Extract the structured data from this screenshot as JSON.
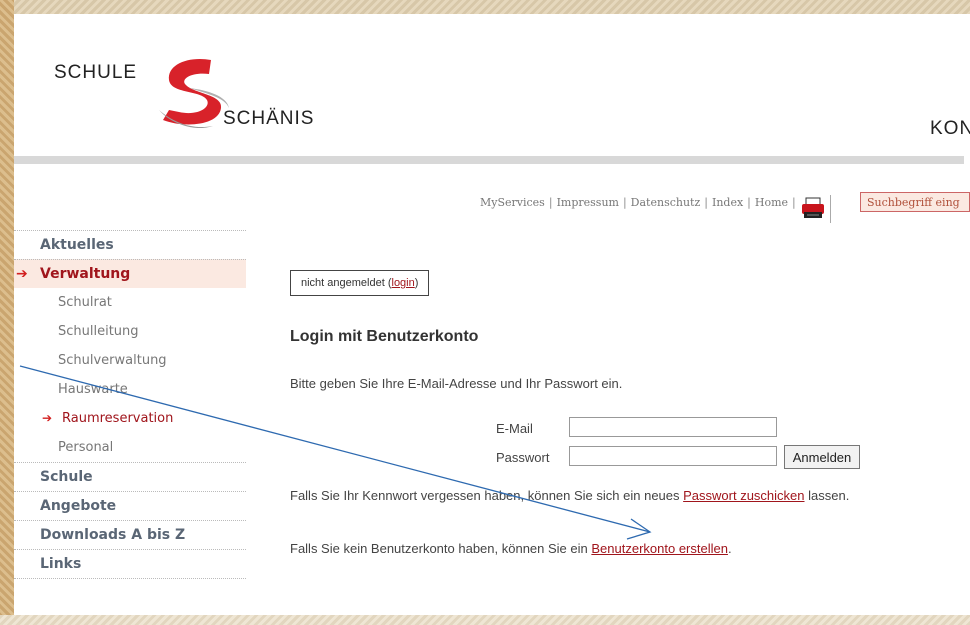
{
  "header": {
    "logo_schule": "SCHULE",
    "logo_schaenis": "SCHÄNIS",
    "right_text": "KON"
  },
  "toplinks": [
    "MyServices",
    "Impressum",
    "Datenschutz",
    "Index",
    "Home"
  ],
  "search": {
    "placeholder": "Suchbegriff eing"
  },
  "sidebar": {
    "items": [
      {
        "label": "Aktuelles"
      },
      {
        "label": "Verwaltung",
        "active": true
      },
      {
        "label": "Schulrat"
      },
      {
        "label": "Schulleitung"
      },
      {
        "label": "Schulverwaltung"
      },
      {
        "label": "Hauswarte"
      },
      {
        "label": "Raumreservation",
        "active": true
      },
      {
        "label": "Personal"
      },
      {
        "label": "Schule"
      },
      {
        "label": "Angebote"
      },
      {
        "label": "Downloads A bis Z"
      },
      {
        "label": "Links"
      }
    ]
  },
  "status": {
    "prefix": "nicht angemeldet (",
    "link": "login",
    "suffix": ")"
  },
  "login": {
    "title": "Login mit Benutzerkonto",
    "intro": "Bitte geben Sie Ihre E-Mail-Adresse und Ihr Passwort ein.",
    "email_label": "E-Mail",
    "password_label": "Passwort",
    "submit_label": "Anmelden",
    "email_value": "",
    "password_value": ""
  },
  "forgot": {
    "prefix": "Falls Sie Ihr Kennwort vergessen haben, können Sie sich ein neues ",
    "link": "Passwort zuschicken",
    "suffix": " lassen."
  },
  "register": {
    "prefix": "Falls Sie kein Benutzerkonto haben, können Sie ein ",
    "link": "Benutzerkonto erstellen",
    "suffix": "."
  },
  "colors": {
    "accent": "#a0151c",
    "active_bg": "#fbe9e1",
    "nav_text": "#5a6675",
    "annotation_arrow": "#2e6ab0"
  }
}
